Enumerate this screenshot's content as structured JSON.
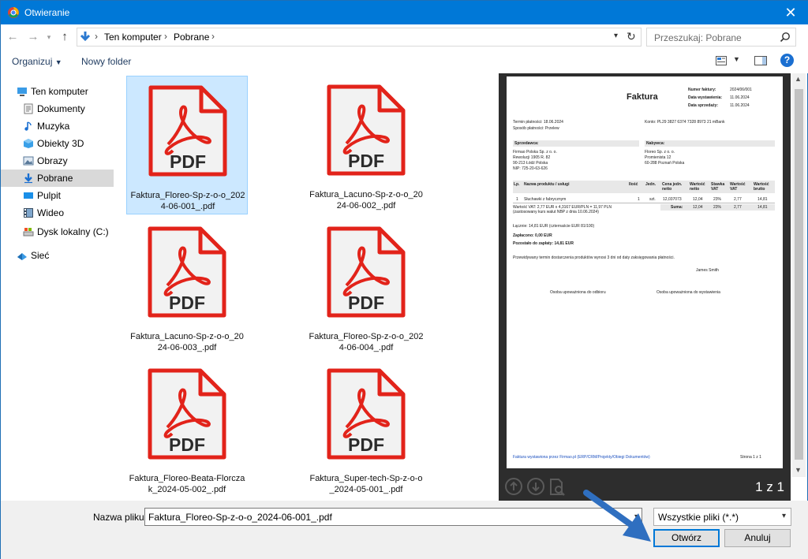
{
  "window": {
    "title": "Otwieranie",
    "close_glyph": "✕"
  },
  "nav": {
    "back_glyph": "←",
    "forward_glyph": "→",
    "up_glyph": "↑",
    "breadcrumb": [
      "Ten komputer",
      "Pobrane"
    ],
    "separator": "›",
    "refresh_glyph": "↻"
  },
  "search": {
    "placeholder": "Przeszukaj: Pobrane"
  },
  "toolbar": {
    "organize_label": "Organizuj",
    "new_folder_label": "Nowy folder",
    "help_glyph": "?"
  },
  "sidebar": {
    "items": [
      {
        "label": "Ten komputer",
        "icon": "computer-icon"
      },
      {
        "label": "Dokumenty",
        "icon": "documents-icon"
      },
      {
        "label": "Muzyka",
        "icon": "music-icon"
      },
      {
        "label": "Obiekty 3D",
        "icon": "3d-objects-icon"
      },
      {
        "label": "Obrazy",
        "icon": "pictures-icon"
      },
      {
        "label": "Pobrane",
        "icon": "downloads-icon",
        "selected": true
      },
      {
        "label": "Pulpit",
        "icon": "desktop-icon"
      },
      {
        "label": "Wideo",
        "icon": "video-icon"
      },
      {
        "label": "Dysk lokalny (C:)",
        "icon": "drive-icon"
      },
      {
        "label": "Sieć",
        "icon": "network-icon"
      }
    ]
  },
  "files": [
    {
      "name": "Faktura_Floreo-Sp-z-o-o_202\n4-06-001_.pdf",
      "selected": true
    },
    {
      "name": "Faktura_Lacuno-Sp-z-o-o_20\n24-06-002_.pdf"
    },
    {
      "name": "Faktura_Lacuno-Sp-z-o-o_20\n24-06-003_.pdf"
    },
    {
      "name": "Faktura_Floreo-Sp-z-o-o_202\n4-06-004_.pdf"
    },
    {
      "name": "Faktura_Floreo-Beata-Florcza\nk_2024-05-002_.pdf"
    },
    {
      "name": "Faktura_Super-tech-Sp-z-o-o\n_2024-05-001_.pdf"
    }
  ],
  "file_icon_label": "PDF",
  "preview": {
    "page_counter": "1 z 1",
    "doc_title": "Faktura",
    "meta": [
      {
        "label": "Numer faktury:",
        "value": "2024/06/001"
      },
      {
        "label": "Data wystawienia:",
        "value": "11.06.2024"
      },
      {
        "label": "Data sprzedaży:",
        "value": "11.06.2024"
      }
    ],
    "payment_due": "Termin płatności: 18.06.2024",
    "payment_method": "Sposób płatności: Przelew",
    "account": "Konto: PL29 3827 6374 7328 8973 21 mBank",
    "seller_header": "Sprzedawca:",
    "seller_lines": [
      "Firmao Polska Sp. z o. o.",
      "Rewolucji 1905 R. 82",
      "90-213 Łódź Polska",
      "NIP: 725-20-63-626"
    ],
    "buyer_header": "Nabywca:",
    "buyer_lines": [
      "Floreo Sp. z o. o.",
      "Promienista 12",
      "60-288 Poznań Polska"
    ],
    "table_headers": [
      "Lp.",
      "Nazwa produktu / usługi",
      "Ilość",
      "Jedn.",
      "Cena jedn. netto",
      "Wartość netto",
      "Stawka VAT",
      "Wartość VAT",
      "Wartość brutto"
    ],
    "table_row": [
      "1",
      "Słuchawki z fabrycznym",
      "1",
      "szt.",
      "12,037073",
      "12,04",
      "23%",
      "2,77",
      "14,81"
    ],
    "vat_note_1": "Wartość VAT: 2,77 EUR x 4,3167 EUR/PLN = 11,97 PLN",
    "vat_note_2": "(zastosowany kurs walut NBP z dnia 10.06.2024)",
    "sum_label": "Suma:",
    "sum_values": [
      "12,04",
      "23%",
      "2,77",
      "14,81"
    ],
    "total_line": "Łącznie: 14,81 EUR (czternaście EUR 81/100)",
    "paid_line": "Zapłacono: 0,00 EUR",
    "remaining_line": "Pozostało do zapłaty: 14,81 EUR",
    "delivery_note": "Przewidywany termin dostarczenia produktów wynosi 3 dni od daty zaksięgowania płatności.",
    "signature": "James Smith",
    "sig_left": "Osoba upoważniona do odbioru",
    "sig_right": "Osoba upoważniona do wystawienia",
    "footer_left": "Faktura wystawiona przez Firmao.pl (ERP/CRM/Projekty/Obiegi Dokumentów)",
    "footer_right": "Strona 1 z 1"
  },
  "bottom": {
    "filename_label": "Nazwa pliku:",
    "filename_value": "Faktura_Floreo-Sp-z-o-o_2024-06-001_.pdf",
    "filetype_value": "Wszystkie pliki (*.*)",
    "open_label": "Otwórz",
    "cancel_label": "Anuluj"
  },
  "colors": {
    "titlebar": "#0078d7",
    "selection": "#cce8ff",
    "pdf_red": "#e2231a",
    "arrow": "#2f6fc0"
  }
}
